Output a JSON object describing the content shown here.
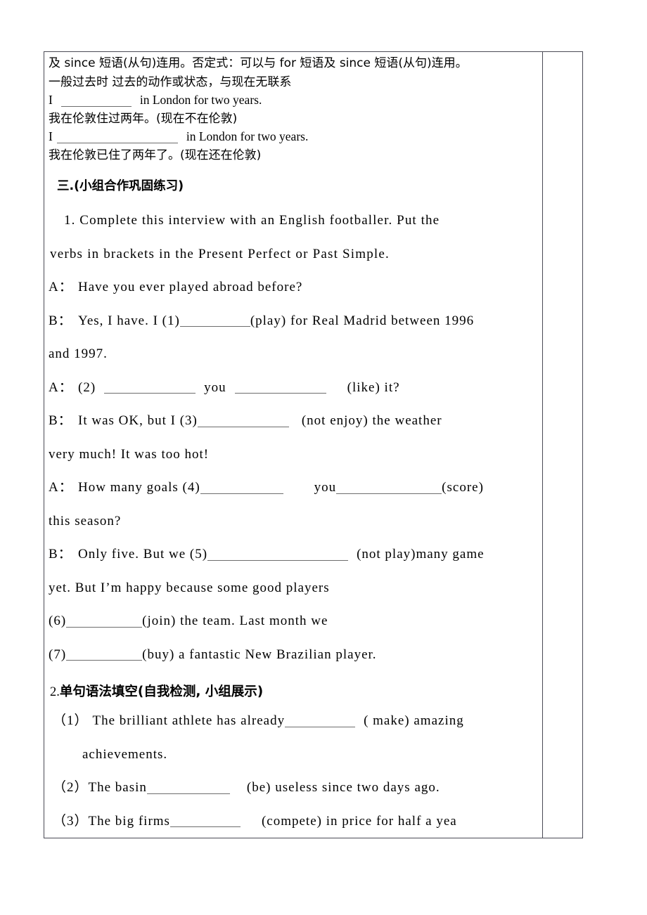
{
  "document": {
    "type": "worksheet",
    "language": "zh-CN + en"
  },
  "grammar_notes": {
    "line_1": "及 since 短语(从句)连用。否定式：可以与 for 短语及 since 短语(从句)连用。",
    "line_2": "一般过去时   过去的动作或状态，与现在无联系",
    "example_1_prefix": "I",
    "example_1_suffix": "in London for two years.",
    "example_1_translation": "我在伦敦住过两年。(现在不在伦敦)",
    "example_2_prefix": "I",
    "example_2_suffix": "in London for two years.",
    "example_2_translation": "我在伦敦已住了两年了。(现在还在伦敦)"
  },
  "section_three": {
    "heading": "三.(小组合作巩固练习)",
    "task_1_line_1": "1. Complete this interview with an English footballer. Put the",
    "task_1_line_2": "verbs in brackets in the Present Perfect or Past Simple."
  },
  "interview": {
    "lines": [
      {
        "speaker": "A：",
        "text": "Have you ever played abroad before?"
      },
      {
        "speaker": "B：",
        "text_before": "Yes, I have. I (1)",
        "text_after": "(play) for Real Madrid between 1996",
        "continuation": "and 1997."
      },
      {
        "speaker": "A：",
        "text_1": "(2)",
        "text_2": "you",
        "text_3": "(like) it?"
      },
      {
        "speaker": "B：",
        "text_before": "It was OK,  but I (3)",
        "text_after": "(not enjoy)  the  weather",
        "continuation": "very much! It was too hot!"
      },
      {
        "speaker": "A：",
        "text_1": "How many goals (4)",
        "text_2": "you",
        "text_3": "(score)",
        "continuation": "this season?"
      },
      {
        "speaker": "B：",
        "text_before": "Only five. But we (5)",
        "text_after": "(not play)many game",
        "continuation_1": "yet.   But   I’m   happy   because   some   good   players",
        "continuation_2_num": "(6)",
        "continuation_2_after": "(join)   the   team.      Last   month   we",
        "continuation_3_num": "(7)",
        "continuation_3_after": "(buy) a fantastic New Brazilian player."
      }
    ]
  },
  "section_two": {
    "heading_number": "2.",
    "heading_text": "单句语法填空(自我检测, 小组展示)",
    "items": [
      {
        "num": "（1）",
        "before": "The brilliant athlete has already",
        "after": "( make) amazing",
        "continuation": "achievements."
      },
      {
        "num": "（2）",
        "before": "The basin",
        "after": "(be) useless since two days ago."
      },
      {
        "num": "（3）",
        "before": "The big firms",
        "after": "(compete)  in price for half a yea"
      }
    ]
  },
  "colors": {
    "text": "#000000",
    "table_border": "#4a4a55",
    "blank_rule": "#6d6d6d",
    "page_background": "#ffffff"
  }
}
